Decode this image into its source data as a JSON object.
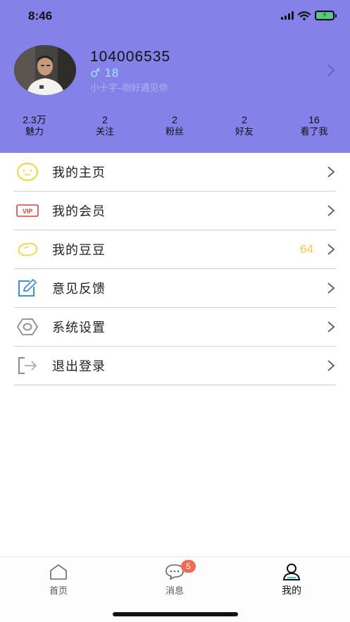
{
  "status_bar": {
    "time": "8:46"
  },
  "profile": {
    "name": "104006535",
    "gender_symbol": "♂",
    "age": "18",
    "signature": "小十字–刚好遇见你"
  },
  "stats": [
    {
      "value": "2.3万",
      "label": "魅力"
    },
    {
      "value": "2",
      "label": "关注"
    },
    {
      "value": "2",
      "label": "粉丝"
    },
    {
      "value": "2",
      "label": "好友"
    },
    {
      "value": "16",
      "label": "看了我"
    }
  ],
  "menu": [
    {
      "label": "我的主页",
      "icon": "smiley-face-icon"
    },
    {
      "label": "我的会员",
      "icon": "vip-icon"
    },
    {
      "label": "我的豆豆",
      "icon": "bean-icon",
      "value": "64"
    },
    {
      "label": "意见反馈",
      "icon": "edit-icon"
    },
    {
      "label": "系统设置",
      "icon": "hexagon-settings-icon"
    },
    {
      "label": "退出登录",
      "icon": "logout-icon"
    }
  ],
  "tabbar": {
    "tabs": [
      {
        "label": "首页",
        "icon": "home-icon"
      },
      {
        "label": "消息",
        "icon": "chat-icon",
        "badge": "5"
      },
      {
        "label": "我的",
        "icon": "user-icon",
        "active": true
      }
    ]
  },
  "colors": {
    "header_bg": "#8481e8",
    "accent_yellow": "#f5c842",
    "vip_red": "#d9433a",
    "edit_blue": "#3f8fd6",
    "badge": "#f06b57"
  }
}
